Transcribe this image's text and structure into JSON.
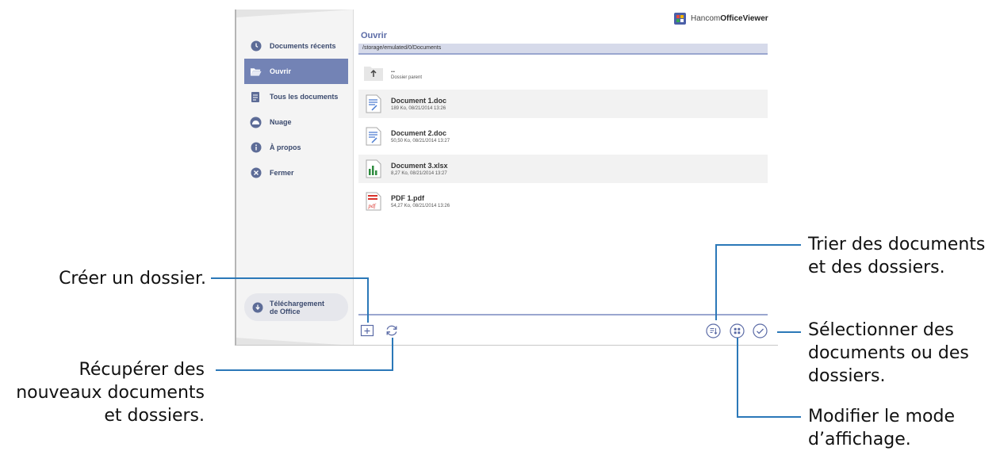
{
  "app": {
    "brand_prefix": "Hancom ",
    "brand_bold": "OfficeViewer"
  },
  "sidebar": {
    "items": [
      {
        "label": "Documents récents",
        "icon": "clock-icon"
      },
      {
        "label": "Ouvrir",
        "icon": "folder-open-icon",
        "active": true
      },
      {
        "label": "Tous les documents",
        "icon": "documents-icon"
      },
      {
        "label": "Nuage",
        "icon": "cloud-icon"
      },
      {
        "label": "À propos",
        "icon": "info-icon"
      },
      {
        "label": "Fermer",
        "icon": "close-icon"
      }
    ],
    "download_label": "Téléchargement de Office"
  },
  "main": {
    "title": "Ouvrir",
    "path": "/storage/emulated/0/Documents",
    "parent": {
      "name": "..",
      "label": "Dossier parent"
    },
    "files": [
      {
        "name": "Document 1.doc",
        "meta": "189 Ko, 08/21/2014 13:26",
        "type": "doc"
      },
      {
        "name": "Document 2.doc",
        "meta": "50,50 Ko, 08/21/2014 13:27",
        "type": "doc"
      },
      {
        "name": "Document 3.xlsx",
        "meta": "8,27 Ko, 08/21/2014 13:27",
        "type": "xlsx"
      },
      {
        "name": "PDF 1.pdf",
        "meta": "54,27 Ko, 08/21/2014 13:26",
        "type": "pdf"
      }
    ]
  },
  "callouts": {
    "create_folder": "Créer un dossier.",
    "refresh": [
      "Récupérer des",
      "nouveaux documents",
      "et dossiers."
    ],
    "sort": [
      "Trier des documents",
      "et des dossiers."
    ],
    "select": [
      "Sélectionner des",
      "documents ou des",
      "dossiers."
    ],
    "view_mode": [
      "Modifier le mode",
      "d’affichage."
    ]
  },
  "colors": {
    "accent": "#7383b5",
    "title": "#5b6ba6",
    "callout_line": "#2b78b8"
  }
}
